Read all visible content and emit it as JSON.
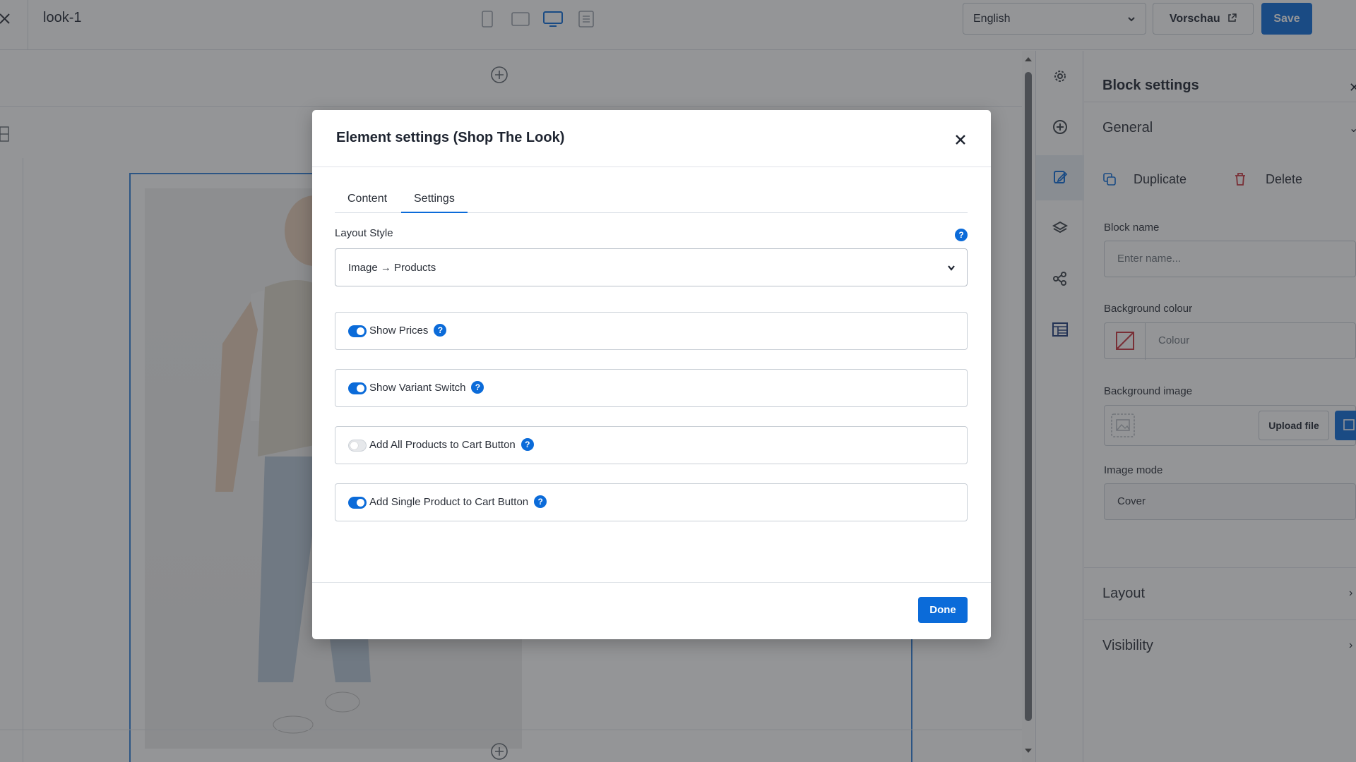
{
  "topbar": {
    "page_title": "look-1",
    "language": "English",
    "preview_label": "Vorschau",
    "save_label": "Save"
  },
  "panel": {
    "title": "Block settings",
    "general_label": "General",
    "duplicate_label": "Duplicate",
    "delete_label": "Delete",
    "block_name_label": "Block name",
    "block_name_placeholder": "Enter name...",
    "background_colour_label": "Background colour",
    "colour_placeholder": "Colour",
    "background_image_label": "Background image",
    "upload_label": "Upload file",
    "image_mode_label": "Image mode",
    "image_mode_value": "Cover",
    "layout_label": "Layout",
    "visibility_label": "Visibility"
  },
  "modal": {
    "title": "Element settings (Shop The Look)",
    "tabs": [
      {
        "label": "Content"
      },
      {
        "label": "Settings"
      }
    ],
    "layout_style_label": "Layout Style",
    "layout_style_value": "Image → Products",
    "options": [
      {
        "label": "Show Prices",
        "on": true
      },
      {
        "label": "Show Variant Switch",
        "on": true
      },
      {
        "label": "Add All Products to Cart Button",
        "on": false
      },
      {
        "label": "Add Single Product to Cart Button",
        "on": true
      }
    ],
    "help_glyph": "?",
    "done_label": "Done"
  },
  "colors": {
    "accent": "#0b6bd9",
    "overlay": "rgba(42,44,48,0.5)"
  }
}
